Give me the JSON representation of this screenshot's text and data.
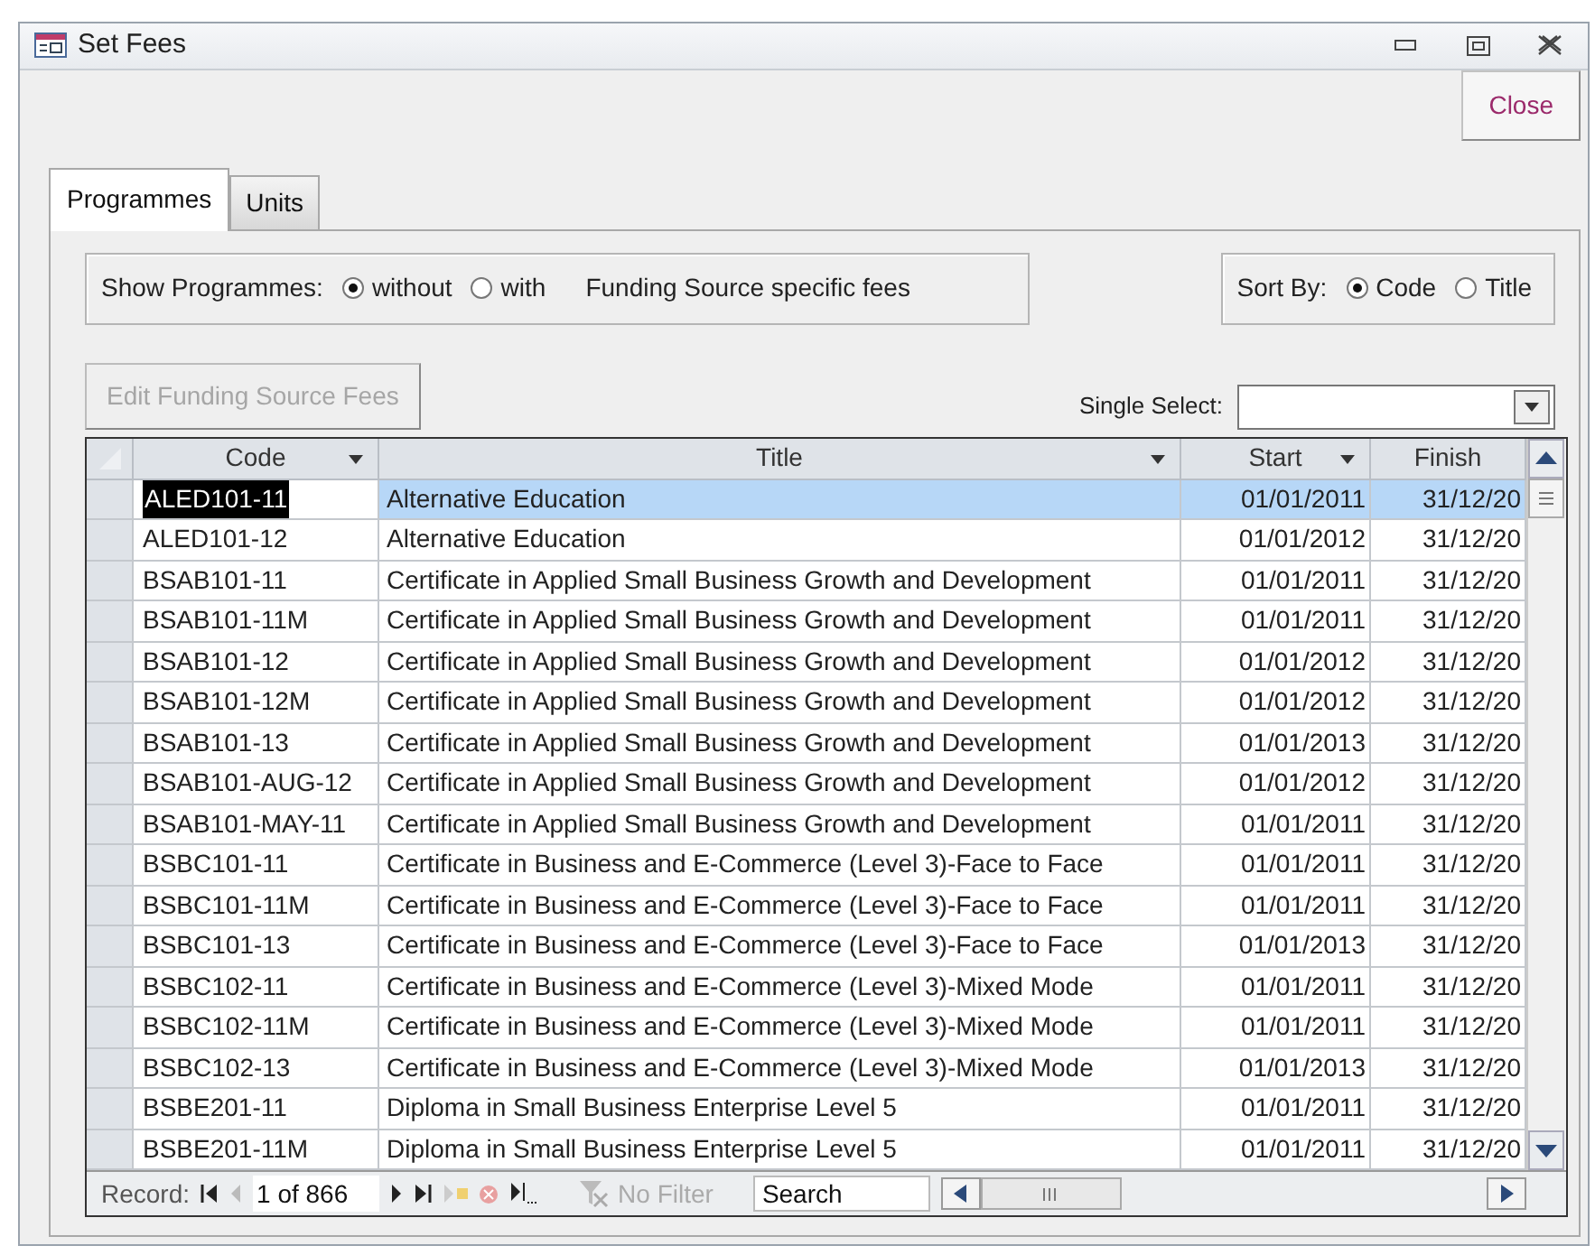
{
  "window": {
    "title": "Set Fees"
  },
  "close_button": "Close",
  "tabs": [
    {
      "label": "Programmes",
      "selected": true
    },
    {
      "label": "Units",
      "selected": false
    }
  ],
  "show_programmes": {
    "label": "Show Programmes:",
    "options": [
      {
        "label": "without",
        "selected": true
      },
      {
        "label": "with",
        "selected": false
      }
    ],
    "suffix": "Funding Source specific fees"
  },
  "sort_by": {
    "label": "Sort By:",
    "options": [
      {
        "label": "Code",
        "selected": true
      },
      {
        "label": "Title",
        "selected": false
      }
    ]
  },
  "edit_button": {
    "label": "Edit Funding Source Fees",
    "disabled": true
  },
  "single_select": {
    "label": "Single Select:"
  },
  "table": {
    "columns": [
      {
        "label": "Code",
        "filter_arrow": true
      },
      {
        "label": "Title",
        "filter_arrow": true
      },
      {
        "label": "Start",
        "filter_arrow": true
      },
      {
        "label": "Finish",
        "filter_arrow": false
      }
    ],
    "rows": [
      {
        "selected": true,
        "cells": [
          "ALED101-11",
          "Alternative Education",
          "01/01/2011",
          "31/12/20"
        ]
      },
      {
        "selected": false,
        "cells": [
          "ALED101-12",
          "Alternative Education",
          "01/01/2012",
          "31/12/20"
        ]
      },
      {
        "selected": false,
        "cells": [
          "BSAB101-11",
          "Certificate in Applied Small Business Growth and Development",
          "01/01/2011",
          "31/12/20"
        ]
      },
      {
        "selected": false,
        "cells": [
          "BSAB101-11M",
          "Certificate in Applied Small Business Growth and Development",
          "01/01/2011",
          "31/12/20"
        ]
      },
      {
        "selected": false,
        "cells": [
          "BSAB101-12",
          "Certificate in Applied Small Business Growth and Development",
          "01/01/2012",
          "31/12/20"
        ]
      },
      {
        "selected": false,
        "cells": [
          "BSAB101-12M",
          "Certificate in Applied Small Business Growth and Development",
          "01/01/2012",
          "31/12/20"
        ]
      },
      {
        "selected": false,
        "cells": [
          "BSAB101-13",
          "Certificate in Applied Small Business Growth and Development",
          "01/01/2013",
          "31/12/20"
        ]
      },
      {
        "selected": false,
        "cells": [
          "BSAB101-AUG-12",
          "Certificate in Applied Small Business Growth and Development",
          "01/01/2012",
          "31/12/20"
        ]
      },
      {
        "selected": false,
        "cells": [
          "BSAB101-MAY-11",
          "Certificate in Applied Small Business Growth and Development",
          "01/01/2011",
          "31/12/20"
        ]
      },
      {
        "selected": false,
        "cells": [
          "BSBC101-11",
          "Certificate in Business and E-Commerce (Level 3)-Face to Face",
          "01/01/2011",
          "31/12/20"
        ]
      },
      {
        "selected": false,
        "cells": [
          "BSBC101-11M",
          "Certificate in Business and E-Commerce (Level 3)-Face to Face",
          "01/01/2011",
          "31/12/20"
        ]
      },
      {
        "selected": false,
        "cells": [
          "BSBC101-13",
          "Certificate in Business and E-Commerce (Level 3)-Face to Face",
          "01/01/2013",
          "31/12/20"
        ]
      },
      {
        "selected": false,
        "cells": [
          "BSBC102-11",
          "Certificate in Business and E-Commerce (Level 3)-Mixed Mode",
          "01/01/2011",
          "31/12/20"
        ]
      },
      {
        "selected": false,
        "cells": [
          "BSBC102-11M",
          "Certificate in Business and E-Commerce (Level 3)-Mixed Mode",
          "01/01/2011",
          "31/12/20"
        ]
      },
      {
        "selected": false,
        "cells": [
          "BSBC102-13",
          "Certificate in Business and E-Commerce (Level 3)-Mixed Mode",
          "01/01/2013",
          "31/12/20"
        ]
      },
      {
        "selected": false,
        "cells": [
          "BSBE201-11",
          "Diploma in Small Business Enterprise Level 5",
          "01/01/2011",
          "31/12/20"
        ]
      },
      {
        "selected": false,
        "cells": [
          "BSBE201-11M",
          "Diploma in Small Business Enterprise Level 5",
          "01/01/2011",
          "31/12/20"
        ]
      }
    ]
  },
  "record_nav": {
    "label": "Record:",
    "position": "1 of 866",
    "filter": "No Filter",
    "search_placeholder": "Search"
  }
}
